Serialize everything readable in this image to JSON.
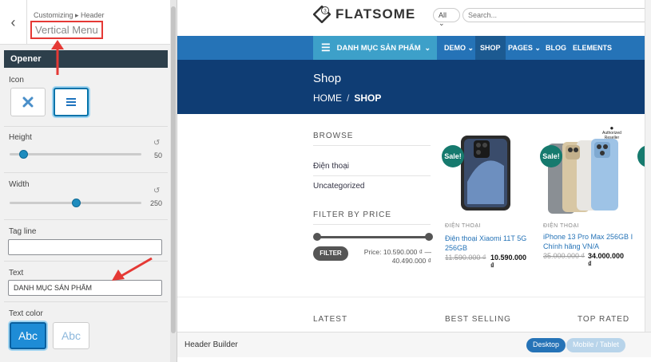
{
  "customizer": {
    "back_glyph": "‹",
    "breadcrumb": "Customizing ▸ Header",
    "section_title": "Vertical Menu",
    "opener_heading": "Opener",
    "icon_label": "Icon",
    "height_label": "Height",
    "height_value": "50",
    "height_fraction": 0.1,
    "width_label": "Width",
    "width_value": "250",
    "width_fraction": 0.5,
    "tagline_label": "Tag line",
    "tagline_value": "",
    "text_label": "Text",
    "text_value": "DANH MỤC SẢN PHẨM",
    "text_color_label": "Text color",
    "color_dark_label": "Abc",
    "color_light_label": "Abc",
    "reset_glyph": "↺"
  },
  "preview": {
    "logo_text": "FLATSOME",
    "logo_badge": "3",
    "search_select": "All",
    "search_placeholder": "Search...",
    "vertical_menu_label": "DANH MỤC SẢN PHẨM",
    "nav": [
      {
        "label": "DEMO",
        "has_chevron": true
      },
      {
        "label": "SHOP",
        "active": true
      },
      {
        "label": "PAGES",
        "has_chevron": true
      },
      {
        "label": "BLOG"
      },
      {
        "label": "ELEMENTS"
      }
    ],
    "nav_demo": "DEMO ⌄",
    "nav_shop": "SHOP",
    "nav_pages": "PAGES ⌄",
    "nav_blog": "BLOG",
    "nav_elements": "ELEMENTS",
    "page_title": "Shop",
    "crumb_home": "HOME",
    "crumb_sep": "/",
    "crumb_current": "SHOP",
    "browse_heading": "BROWSE",
    "browse_links": [
      "Điện thoại",
      "Uncategorized"
    ],
    "filter_heading": "FILTER BY PRICE",
    "filter_button": "FILTER",
    "price_line1": "Price: 10.590.000 ₫ —",
    "price_line2": "40.490.000 ₫",
    "products": [
      {
        "sale": "Sale!",
        "category": "ĐIỆN THOẠI",
        "name_line1": "Điện thoại Xiaomi 11T 5G",
        "name_line2": "256GB",
        "old_price": "11.590.000 ₫",
        "new_price": "10.590.000 ₫"
      },
      {
        "sale": "Sale!",
        "category": "ĐIỆN THOẠI",
        "name_line1": "iPhone 13 Pro Max 256GB I",
        "name_line2": "Chính hãng VN/A",
        "old_price": "35.000.000 ₫",
        "new_price": "34.000.000 ₫",
        "reseller_line1": "Authorized",
        "reseller_line2": "Reseller"
      }
    ],
    "bottom_headings": [
      "LATEST",
      "BEST SELLING",
      "TOP RATED"
    ],
    "header_builder_label": "Header Builder",
    "desktop_button": "Desktop",
    "mobile_button": "Mobile / Tablet"
  },
  "colors": {
    "nav_blue": "#2573b7",
    "vertical_menu": "#3da0c9",
    "title_band": "#0f3d74",
    "sale_badge": "#167a6e",
    "annotation_red": "#e53935"
  }
}
